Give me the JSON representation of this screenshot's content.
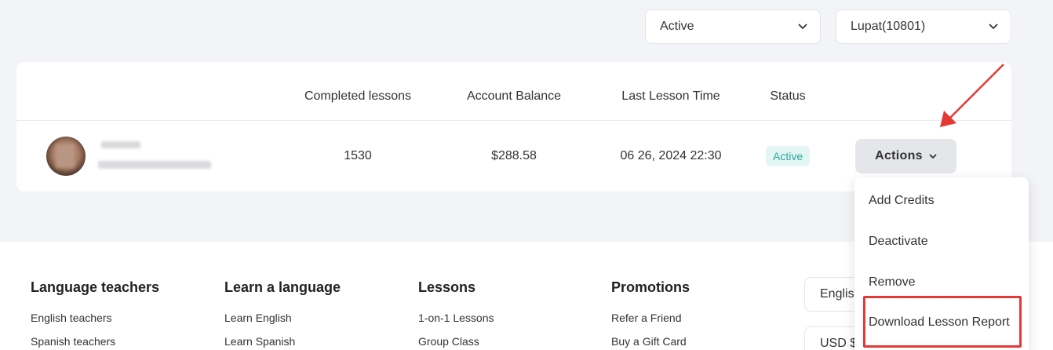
{
  "filters": {
    "status_value": "Active",
    "group_value": "Lupat(10801)",
    "chevron_icon": "chevron-down-icon"
  },
  "table": {
    "columns": [
      "Completed lessons",
      "Account Balance",
      "Last Lesson Time",
      "Status"
    ],
    "rows": [
      {
        "completed_lessons": "1530",
        "account_balance": "$288.58",
        "last_lesson_time": "06 26, 2024 22:30",
        "status": "Active",
        "actions_label": "Actions"
      }
    ]
  },
  "actions_menu": {
    "items": [
      "Add Credits",
      "Deactivate",
      "Remove",
      "Download Lesson Report"
    ]
  },
  "footer": {
    "columns": [
      {
        "title": "Language teachers",
        "links": [
          "English teachers",
          "Spanish teachers"
        ]
      },
      {
        "title": "Learn a language",
        "links": [
          "Learn English",
          "Learn Spanish"
        ]
      },
      {
        "title": "Lessons",
        "links": [
          "1-on-1 Lessons",
          "Group Class"
        ]
      },
      {
        "title": "Promotions",
        "links": [
          "Refer a Friend",
          "Buy a Gift Card"
        ]
      }
    ],
    "language_selector": "English",
    "currency_selector": "USD $"
  },
  "annotation": {
    "highlight_color": "#e53935"
  },
  "colors": {
    "status_active_bg": "#e3f6f4",
    "status_active_text": "#2aa89a",
    "actions_button_bg": "#e4e6ea"
  }
}
